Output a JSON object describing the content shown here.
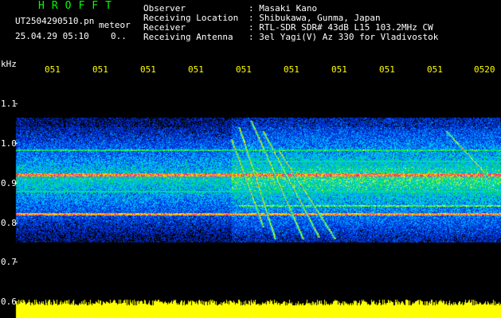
{
  "header": {
    "logo_text": "HROFFT",
    "filename": "UT2504290510.pn",
    "mode": "meteor",
    "datetime": "25.04.29 05:10",
    "extra": "0..",
    "info_rows": [
      {
        "label": "Observer",
        "value": ": Masaki Kano"
      },
      {
        "label": "Receiving Location",
        "value": ": Shibukawa, Gunma, Japan"
      },
      {
        "label": "Receiver",
        "value": ": RTL-SDR SDR# 43dB L15 103.2MHz CW"
      },
      {
        "label": "Receiving Antenna",
        "value": ": 3el Yagi(V) Az 330 for Vladivostok"
      }
    ]
  },
  "axis": {
    "unit": "kHz",
    "time_labels": [
      "051",
      "051",
      "051",
      "051",
      "051",
      "051",
      "051",
      "051",
      "051",
      "0520"
    ],
    "freq_labels": [
      "1.1",
      "1.0",
      "0.9",
      "0.8",
      "0.7",
      "0.6"
    ]
  },
  "colors": {
    "text_white": "#ffffff",
    "text_green": "#00ff00",
    "text_yellow": "#ffff00",
    "background": "#000000",
    "signal_hot": "#ff3080",
    "noise_floor": "#0020c0",
    "bottom_band": "#ffff00"
  }
}
